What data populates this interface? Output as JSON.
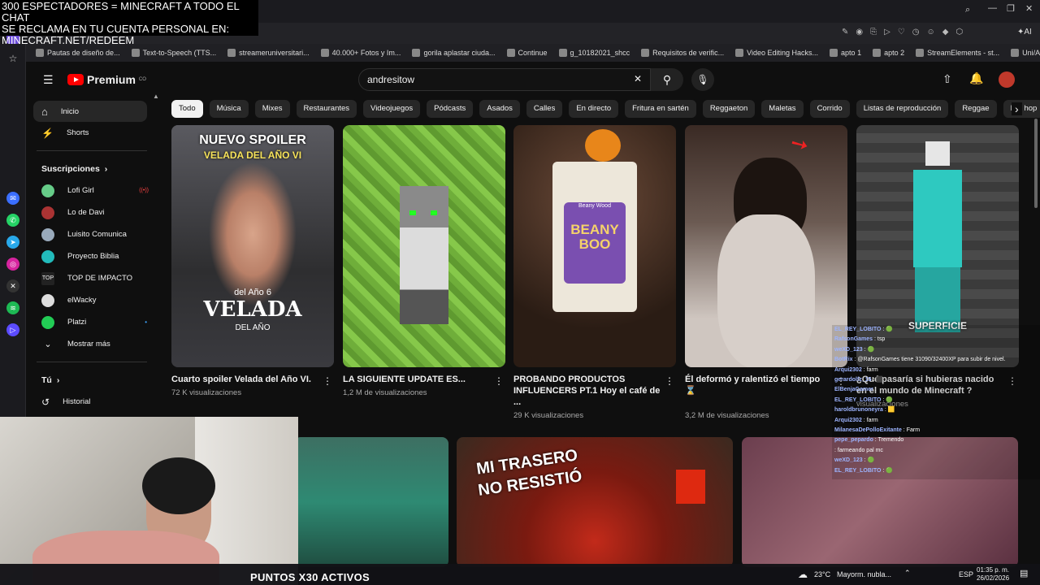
{
  "overlay": {
    "line1": "300 ESPECTADORES = MINECRAFT A TODO EL CHAT",
    "line2": "SE RECLAMA EN TU CUENTA PERSONAL EN:",
    "line3": "MINECRAFT.NET/REDEEM"
  },
  "bookmarks": [
    "Pautas de diseño de...",
    "Text-to-Speech (TTS...",
    "streameruniversitari...",
    "40.000+ Fotos y Im...",
    "gorila aplastar ciuda...",
    "Continue",
    "g_10182021_shcc",
    "Requisitos de verific...",
    "Video Editing Hacks...",
    "apto 1",
    "apto 2",
    "StreamElements - st...",
    "Uni/Aris (@streame..."
  ],
  "browser_ai_label": "AI",
  "youtube": {
    "logo_text": "Premium",
    "logo_badge": "CO",
    "search_value": "andresitow",
    "sidebar": {
      "main": [
        {
          "label": "Inicio",
          "icon": "home-icon"
        },
        {
          "label": "Shorts",
          "icon": "shorts-icon"
        }
      ],
      "subs_header": "Suscripciones",
      "subs": [
        "Lofi Girl",
        "Lo de Davi",
        "Luisito Comunica",
        "Proyecto Biblia",
        "TOP DE IMPACTO",
        "elWacky",
        "Platzi",
        "Mostrar más"
      ],
      "you_header": "Tú",
      "history": "Historial"
    },
    "chips": [
      "Todo",
      "Música",
      "Mixes",
      "Restaurantes",
      "Videojuegos",
      "Pódcasts",
      "Asados",
      "Calles",
      "En directo",
      "Fritura en sartén",
      "Reggaeton",
      "Maletas",
      "Corrido",
      "Listas de reproducción",
      "Reggae",
      "Hip hop"
    ],
    "videos": [
      {
        "title": "Cuarto spoiler Velada del Año VI.",
        "meta": "72 K visualizaciones",
        "thumb_title_1": "NUEVO SPOILER",
        "thumb_title_2": "VELADA DEL AÑO VI",
        "thumb_small": "del Año 6",
        "thumb_big": "VELADA",
        "thumb_sub": "DEL AÑO"
      },
      {
        "title": "LA SIGUIENTE UPDATE ES...",
        "meta": "1,2 M de visualizaciones"
      },
      {
        "title": "PROBANDO PRODUCTOS INFLUENCERS PT.1 Hoy el café de ...",
        "meta": "29 K visualizaciones",
        "bag_brand": "Beany Wood",
        "bag_name": "BEANY BOO"
      },
      {
        "title": "Él deformó y ralentizó el tiempo ⌛",
        "meta": "3,2 M de visualizaciones"
      },
      {
        "title": "¿Qué pasaría si hubieras nacido en el mundo de Minecraft ?",
        "meta": "visualizaciones",
        "thumb_label": "SUPERFICIE"
      }
    ],
    "row2": {
      "thumb_text_1": "MI TRASERO",
      "thumb_text_2": "NO RESISTIÓ"
    }
  },
  "chat": [
    {
      "user": "EL_REY_LOBITO",
      "msg": "🟢"
    },
    {
      "user": "RafsonGames",
      "msg": "tsp"
    },
    {
      "user": "weXD_123",
      "msg": "🟢"
    },
    {
      "user": "BotRix",
      "msg": "@RafsonGames tiene 31090/32400XP para subir de nivel."
    },
    {
      "user": "Arqui2302",
      "msg": "farm"
    },
    {
      "user": "gerardolfz_15",
      "msg": "⬛"
    },
    {
      "user": "ElBenjaGamer",
      "msg": ""
    },
    {
      "user": "EL_REY_LOBITO",
      "msg": "🟢"
    },
    {
      "user": "haroldbrunoneyra",
      "msg": "🟨"
    },
    {
      "user": "Arqui2302",
      "msg": "farm"
    },
    {
      "user": "MilanesaDePolloExitante",
      "msg": "Farm"
    },
    {
      "user": "pepe_pepardo",
      "msg": "Tremendo"
    },
    {
      "user": "",
      "msg": "farmeando pal mc"
    },
    {
      "user": "weXD_123",
      "msg": "🟢"
    },
    {
      "user": "EL_REY_LOBITO",
      "msg": "🟢"
    }
  ],
  "taskbar": {
    "temp": "23°C",
    "weather": "Mayorm. nubla...",
    "lang": "ESP",
    "time": "01:35 p. m.",
    "date": "26/02/2026"
  },
  "puntos": "PUNTOS X30 ACTIVOS"
}
